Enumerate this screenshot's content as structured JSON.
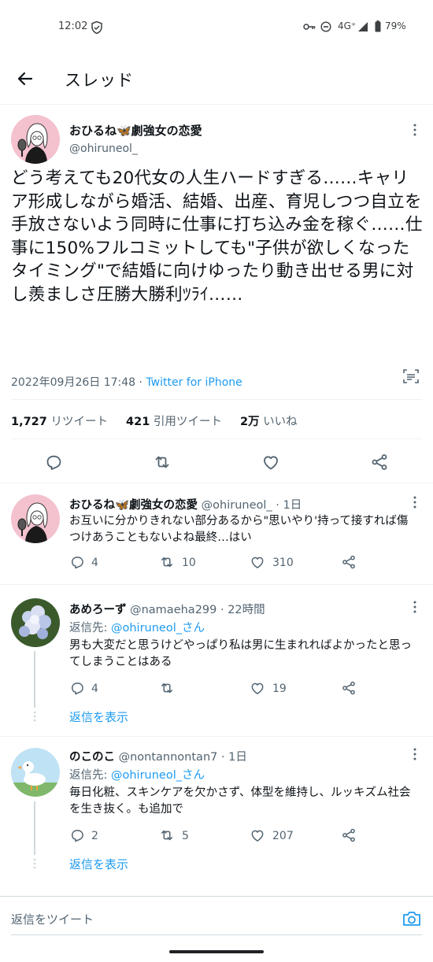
{
  "status_bar": {
    "time": "12:02",
    "network": "4G⁺",
    "battery": "79%"
  },
  "header": {
    "title": "スレッド"
  },
  "main_tweet": {
    "name": "おひるね🦋劇強女の恋愛",
    "handle": "@ohiruneol_",
    "body": "どう考えても20代女の人生ハードすぎる……キャリア形成しながら婚活、結婚、出産、育児しつつ自立を手放さないよう同時に仕事に打ち込み金を稼ぐ……仕事に150%フルコミットしても\"子供が欲しくなったタイミング\"で結婚に向けゆったり動き出せる男に対し羨ましさ圧勝大勝利ﾂﾗｲ……",
    "timestamp": "2022年09月26日 17:48",
    "separator": "·",
    "source": "Twitter for iPhone",
    "retweets_count": "1,727",
    "retweets_label": "リツイート",
    "quotes_count": "421",
    "quotes_label": "引用ツイート",
    "likes_count": "2万",
    "likes_label": "いいね"
  },
  "replies": [
    {
      "name": "おひるね🦋劇強女の恋愛",
      "handle": "@ohiruneol_",
      "time": "· 1日",
      "text": "お互いに分かりきれない部分あるから\"思いやり'持って接すれば傷つけあうこともないよね最終…はい",
      "reply_count": "4",
      "retweet_count": "10",
      "like_count": "310"
    },
    {
      "name": "あめろーず",
      "handle": "@namaeha299",
      "time": "· 22時間",
      "reply_to_label": "返信先:",
      "reply_to_handle": "@ohiruneol_さん",
      "text": "男も大変だと思うけどやっぱり私は男に生まれればよかったと思ってしまうことはある",
      "reply_count": "4",
      "retweet_count": "",
      "like_count": "19",
      "show_replies": "返信を表示"
    },
    {
      "name": "のこのこ",
      "handle": "@nontannontan7",
      "time": "· 1日",
      "reply_to_label": "返信先:",
      "reply_to_handle": "@ohiruneol_さん",
      "text": "毎日化粧、スキンケアを欠かさず、体型を維持し、ルッキズム社会を生き抜く。も追加で",
      "reply_count": "2",
      "retweet_count": "5",
      "like_count": "207",
      "show_replies": "返信を表示"
    }
  ],
  "reply_composer": {
    "placeholder": "返信をツイート"
  },
  "colors": {
    "accent": "#1d9bf0",
    "text": "#0f1419",
    "muted": "#536471",
    "divider": "#eff3f4"
  },
  "icons": [
    "back-arrow-icon",
    "reply-icon",
    "retweet-icon",
    "like-icon",
    "share-icon",
    "more-icon",
    "camera-icon",
    "text-detect-icon",
    "vpn-key-icon",
    "dnd-icon",
    "signal-icon",
    "battery-icon",
    "shield-icon"
  ]
}
